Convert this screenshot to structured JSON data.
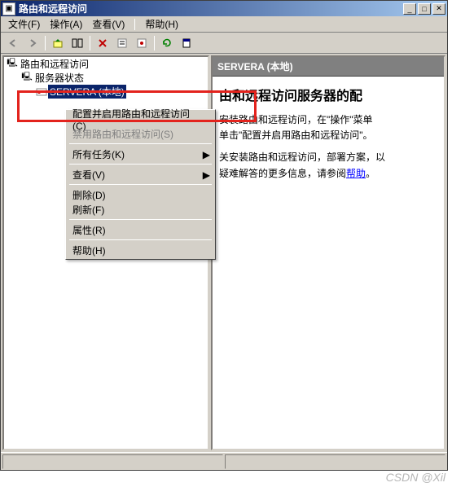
{
  "title": "路由和远程访问",
  "menubar": {
    "file": "文件(F)",
    "action": "操作(A)",
    "view": "查看(V)",
    "help": "帮助(H)"
  },
  "tree": {
    "root": "路由和远程访问",
    "status": "服务器状态",
    "server": "SERVERA (本地)"
  },
  "content": {
    "header": "SERVERA (本地)",
    "title_partial": "由和远程访问服务器的配",
    "para1a": "安装路由和远程访问，在\"操作\"菜单",
    "para1b": "单击\"配置并启用路由和远程访问\"。",
    "para2a": "关安装路由和远程访问，部署方案，以",
    "para2b": "疑难解答的更多信息，请参阅",
    "help_link": "帮助",
    "period": "。"
  },
  "context_menu": {
    "configure": "配置并启用路由和远程访问(C)",
    "disable": "禁用路由和远程访问(S)",
    "all_tasks": "所有任务(K)",
    "view": "查看(V)",
    "delete": "删除(D)",
    "refresh": "刷新(F)",
    "properties": "属性(R)",
    "help": "帮助(H)"
  },
  "watermark": "CSDN @Xil"
}
